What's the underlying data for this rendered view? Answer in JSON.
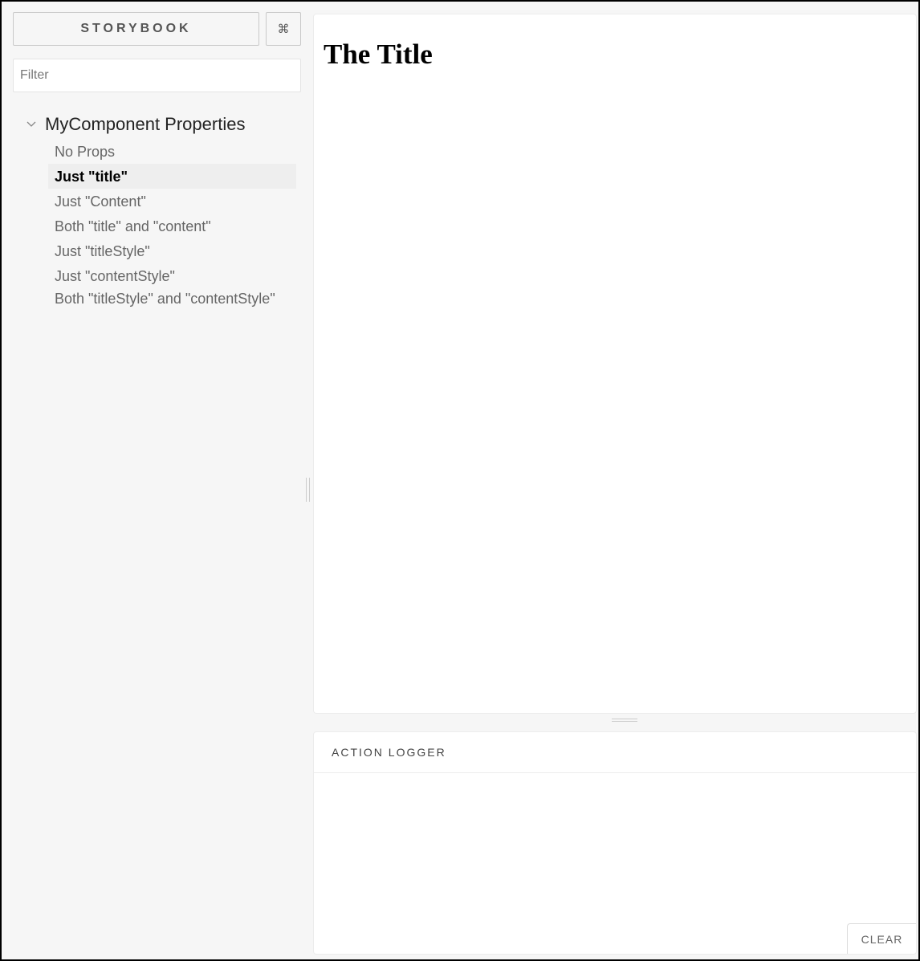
{
  "sidebar": {
    "brand_label": "STORYBOOK",
    "shortcuts_label": "⌘",
    "filter_placeholder": "Filter",
    "filter_value": "",
    "kind": {
      "label": "MyComponent Properties",
      "icon": "chevron-down-icon",
      "expanded": true
    },
    "stories": [
      {
        "label": "No Props",
        "selected": false
      },
      {
        "label": "Just \"title\"",
        "selected": true
      },
      {
        "label": "Just \"Content\"",
        "selected": false
      },
      {
        "label": "Both \"title\" and \"content\"",
        "selected": false
      },
      {
        "label": "Just \"titleStyle\"",
        "selected": false
      },
      {
        "label": "Just \"contentStyle\"",
        "selected": false
      },
      {
        "label": "Both \"titleStyle\" and \"contentStyle\"",
        "selected": false
      }
    ]
  },
  "preview": {
    "title": "The Title"
  },
  "addon_panel": {
    "active_tab": "ACTION LOGGER",
    "clear_label": "CLEAR"
  },
  "colors": {
    "sidebar_background": "#f6f6f6",
    "selected_story_background": "#eeeeee",
    "panel_background": "#ffffff",
    "frame_border": "#000000"
  }
}
